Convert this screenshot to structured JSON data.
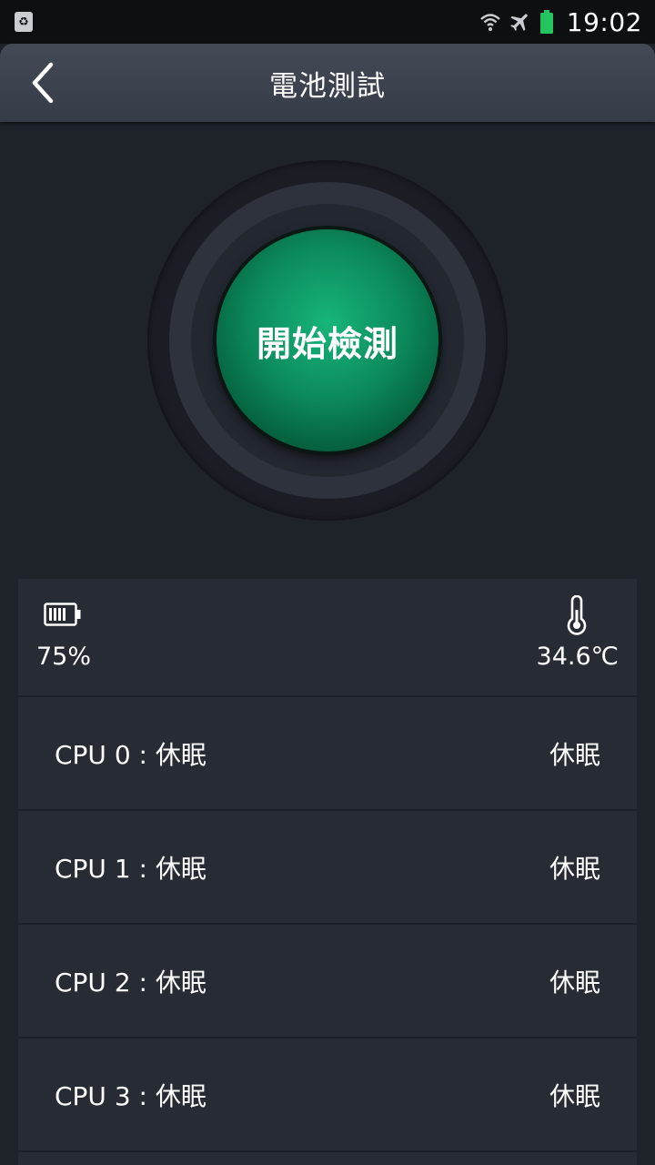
{
  "status_bar": {
    "time": "19:02",
    "icons": [
      "recycle-notification-icon",
      "wifi-icon",
      "airplane-icon",
      "battery-icon"
    ],
    "battery_color": "#22c55e"
  },
  "app_bar": {
    "title": "電池測試",
    "back_icon": "chevron-left-icon"
  },
  "start_button": {
    "label": "開始檢測",
    "color": "#0c8a5b"
  },
  "stats": {
    "battery_level": "75%",
    "battery_icon": "battery-icon",
    "temperature": "34.6℃",
    "temperature_icon": "thermometer-icon"
  },
  "cpus": [
    {
      "label": "CPU  0 : 休眠",
      "status": "休眠"
    },
    {
      "label": "CPU  1 : 休眠",
      "status": "休眠"
    },
    {
      "label": "CPU  2 : 休眠",
      "status": "休眠"
    },
    {
      "label": "CPU  3 : 休眠",
      "status": "休眠"
    }
  ]
}
